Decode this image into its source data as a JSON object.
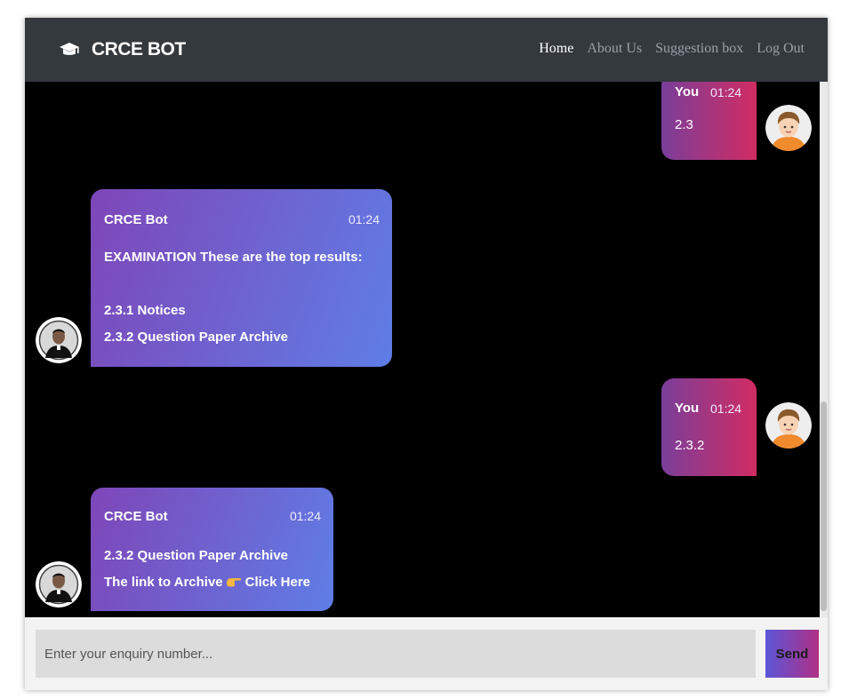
{
  "brand": {
    "name": "CRCE BOT",
    "icon": "graduation-cap-icon"
  },
  "nav": {
    "items": [
      {
        "label": "Home",
        "active": true
      },
      {
        "label": "About Us",
        "active": false
      },
      {
        "label": "Suggestion box",
        "active": false
      },
      {
        "label": "Log Out",
        "active": false
      }
    ]
  },
  "messages": [
    {
      "sender": "You",
      "time": "01:24",
      "text": "2.3"
    },
    {
      "sender": "CRCE Bot",
      "time": "01:24",
      "lines": [
        "EXAMINATION These are the top results:",
        "2.3.1 Notices",
        "2.3.2 Question Paper Archive"
      ]
    },
    {
      "sender": "You",
      "time": "01:24",
      "text": "2.3.2"
    },
    {
      "sender": "CRCE Bot",
      "time": "01:24",
      "lines": [
        "2.3.2 Question Paper Archive"
      ],
      "link_prefix": "The link to Archive",
      "link_text": "Click Here",
      "link_icon": "pointing-hand-icon"
    }
  ],
  "composer": {
    "placeholder": "Enter your enquiry number...",
    "send_label": "Send"
  },
  "colors": {
    "navbar": "#34393e",
    "chat_background": "#000000",
    "user_bubble_start": "#7a3e9a",
    "user_bubble_end": "#d12c62",
    "bot_bubble_start": "#7e46b8",
    "bot_bubble_end": "#5f7ee6"
  }
}
